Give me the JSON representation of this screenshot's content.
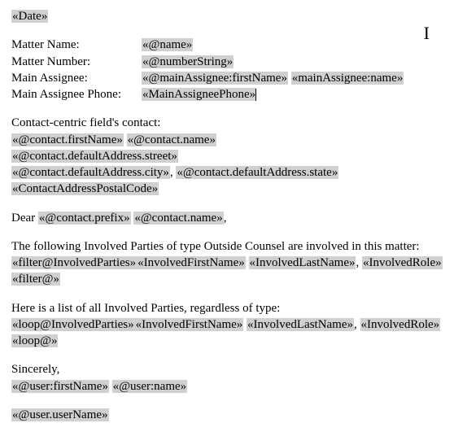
{
  "header": {
    "date_field": "«Date»"
  },
  "matter": {
    "name_label": "Matter Name:",
    "name_field": "«@name»",
    "number_label": "Matter Number:",
    "number_field": "«@numberString»",
    "assignee_label": "Main Assignee:",
    "assignee_first": "«@mainAssignee:firstName»",
    "assignee_last": "«mainAssignee:name»",
    "assignee_phone_label": "Main Assignee Phone:",
    "assignee_phone_field": "«MainAssigneePhone»"
  },
  "contact": {
    "heading": "Contact-centric field's contact:",
    "first_name": "«@contact.firstName»",
    "name": "«@contact.name»",
    "street": "«@contact.defaultAddress.street»",
    "city": "«@contact.defaultAddress.city»",
    "state": "«@contact.defaultAddress.state»",
    "postal": "«ContactAddressPostalCode»",
    "comma": ", "
  },
  "salutation": {
    "dear": "Dear ",
    "prefix": "«@contact.prefix»",
    "name": "«@contact.name»",
    "comma": ","
  },
  "filter_block": {
    "intro": "The following Involved Parties of type Outside Counsel are involved in this matter:",
    "open": "«filter@InvolvedParties»",
    "first": "«InvolvedFirstName»",
    "last": "«InvolvedLastName»",
    "role": "«InvolvedRole»",
    "close": "«filter@»",
    "comma": ", "
  },
  "loop_block": {
    "intro": "Here is a list of all Involved Parties, regardless of type:",
    "open": "«loop@InvolvedParties»",
    "first": "«InvolvedFirstName»",
    "last": "«InvolvedLastName»",
    "role": "«InvolvedRole»",
    "close": "«loop@»",
    "comma": ", "
  },
  "closing": {
    "sincerely": "Sincerely,",
    "user_first": "«@user:firstName»",
    "user_name": "«@user:name»",
    "user_username": "«@user.userName»"
  }
}
